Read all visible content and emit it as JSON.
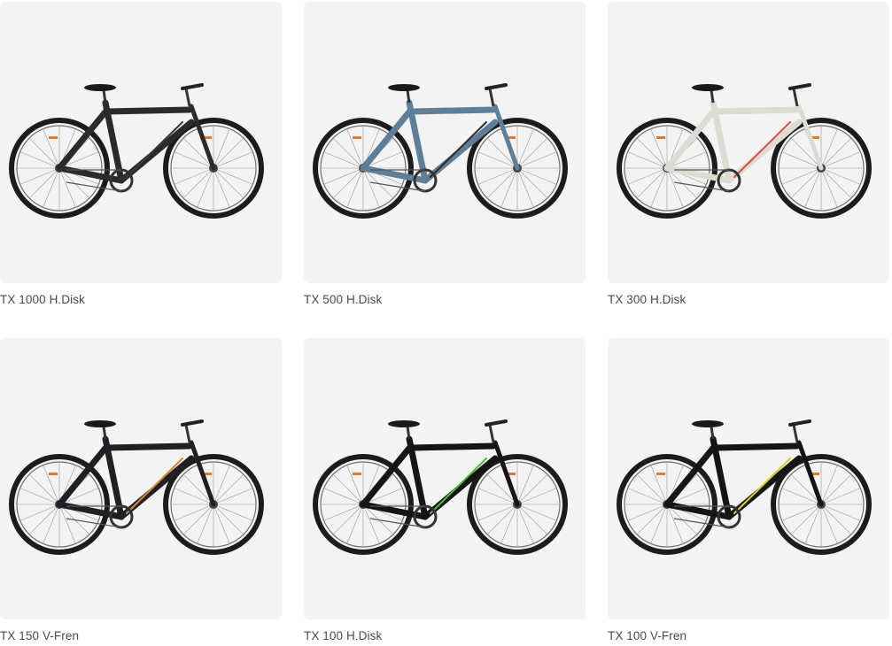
{
  "products": [
    {
      "name": "TX 1000 H.Disk",
      "image": "bicycle-image",
      "frame_color": "#2b2b2b",
      "accent_color": "#3a3a3a"
    },
    {
      "name": "TX 500 H.Disk",
      "image": "bicycle-image",
      "frame_color": "#5f7f99",
      "accent_color": "#2a2a2a"
    },
    {
      "name": "TX 300 H.Disk",
      "image": "bicycle-image",
      "frame_color": "#dcdcd2",
      "accent_color": "#d94c4c"
    },
    {
      "name": "TX 150 V-Fren",
      "image": "bicycle-image",
      "frame_color": "#1f1f24",
      "accent_color": "#d08a3a"
    },
    {
      "name": "TX 100 H.Disk",
      "image": "bicycle-image",
      "frame_color": "#151515",
      "accent_color": "#5ab82d"
    },
    {
      "name": "TX 100 V-Fren",
      "image": "bicycle-image",
      "frame_color": "#151515",
      "accent_color": "#d9cc2e"
    }
  ]
}
